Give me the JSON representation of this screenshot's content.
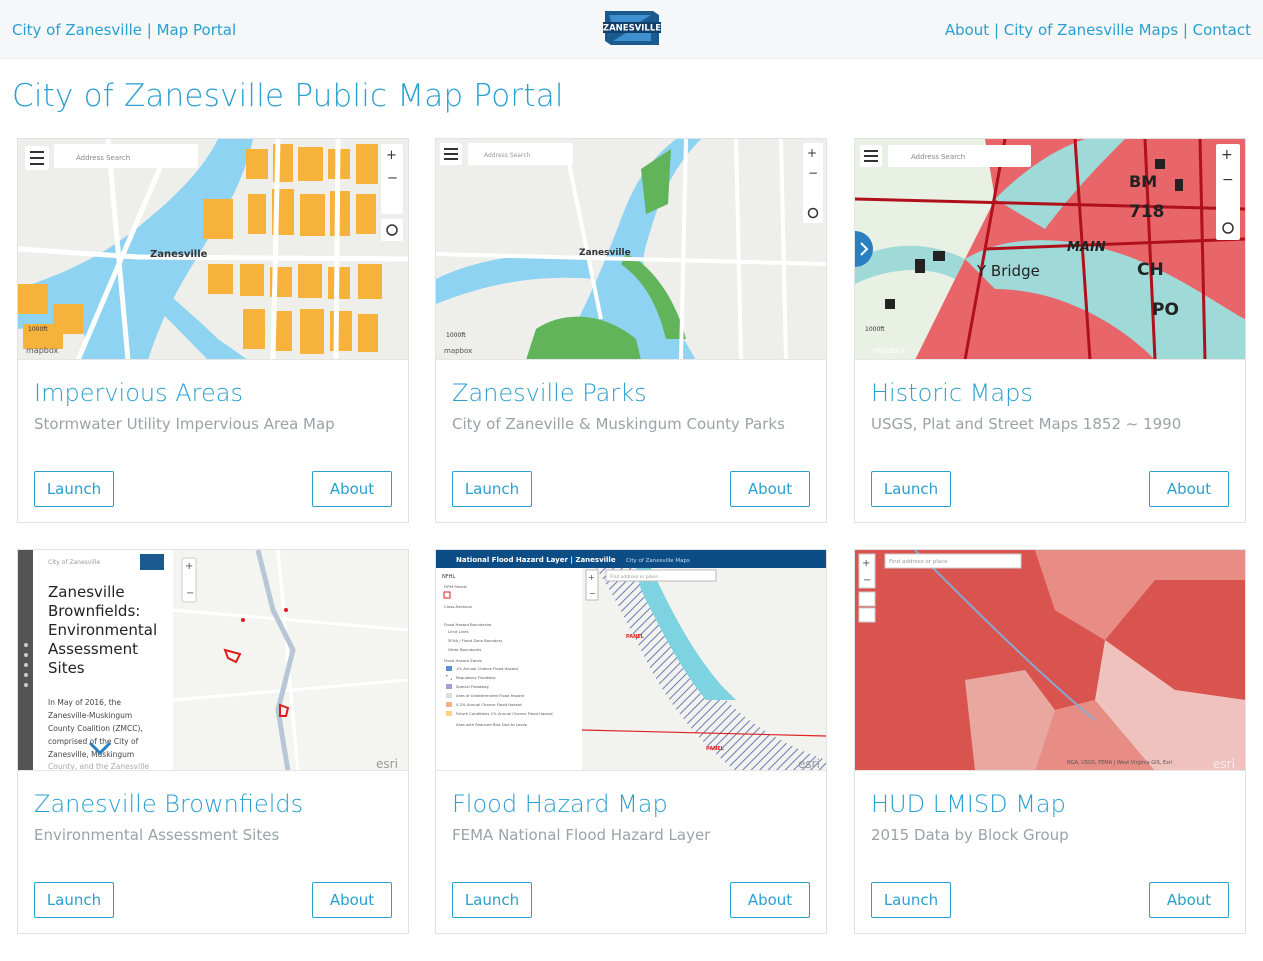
{
  "header": {
    "brand": "City of Zanesville | Map Portal",
    "logo_text": "ZANESVILLE",
    "links": [
      {
        "label": "About"
      },
      {
        "label": "City of Zanesville Maps"
      },
      {
        "label": "Contact"
      }
    ],
    "separator": " | "
  },
  "page_title": "City of Zanesville Public Map Portal",
  "cards": [
    {
      "title": "Impervious Areas",
      "subtitle": "Stormwater Utility Impervious Area Map",
      "launch": "Launch",
      "about": "About"
    },
    {
      "title": "Zanesville Parks",
      "subtitle": "City of Zaneville & Muskingum County Parks",
      "launch": "Launch",
      "about": "About"
    },
    {
      "title": "Historic Maps",
      "subtitle": "USGS, Plat and Street Maps 1852 ~ 1990",
      "launch": "Launch",
      "about": "About"
    },
    {
      "title": "Zanesville Brownfields",
      "subtitle": "Environmental Assessment Sites",
      "launch": "Launch",
      "about": "About"
    },
    {
      "title": "Flood Hazard Map",
      "subtitle": "FEMA National Flood Hazard Layer",
      "launch": "Launch",
      "about": "About"
    },
    {
      "title": "HUD LMISD Map",
      "subtitle": "2015 Data by Block Group",
      "launch": "Launch",
      "about": "About"
    }
  ],
  "thumbs": {
    "search_placeholder": "Address Search",
    "city_label": "Zanesville",
    "scale_label": "1000ft",
    "mapbox": "mapbox",
    "esri": "esri",
    "historic_labels": [
      "BM",
      "718",
      "MAIN",
      "CH",
      "PO",
      "Y Bridge"
    ],
    "brownfields": {
      "panel_title": "Zanesville Brownfields: Environmental Assessment Sites",
      "panel_text": "In May of 2016, the Zanesville-Muskingum County Coalition (ZMCC), comprised of the City of Zanesville, Muskingum County, and the Zanesville",
      "header_text": "City of Zanesville"
    },
    "flood": {
      "header_title": "National Flood Hazard Layer | Zanesville",
      "header_link": "City of Zanesville Maps",
      "legend_title": "NFHL",
      "search_placeholder": "Find address or place",
      "legend_items": [
        "FIRM Panels",
        "Cross-Sections",
        "Flood Hazard Boundaries",
        "Limit Lines",
        "SFHA / Flood Zone Boundary",
        "Other Boundaries",
        "Flood Hazard Zones",
        "1% Annual Chance Flood Hazard",
        "Regulatory Floodway",
        "Special Floodway",
        "Area of Undetermined Flood Hazard",
        "0.2% Annual Chance Flood Hazard",
        "Future Conditions 1% Annual Chance Flood Hazard",
        "Area with Reduced Risk Due to Levee"
      ],
      "panel_label": "PANEL"
    },
    "hud": {
      "search_placeholder": "Find address or place",
      "attribution": "NGA, USGS, FEMA | West Virginia GIS, Esri"
    }
  },
  "colors": {
    "accent": "#2a9fd0",
    "muted": "#9aa3a8",
    "impervious": "#f7b23b",
    "water": "#8fd3f2",
    "park": "#62b45a",
    "historic_red": "#e8656a",
    "hud_red": "#d9534f"
  }
}
